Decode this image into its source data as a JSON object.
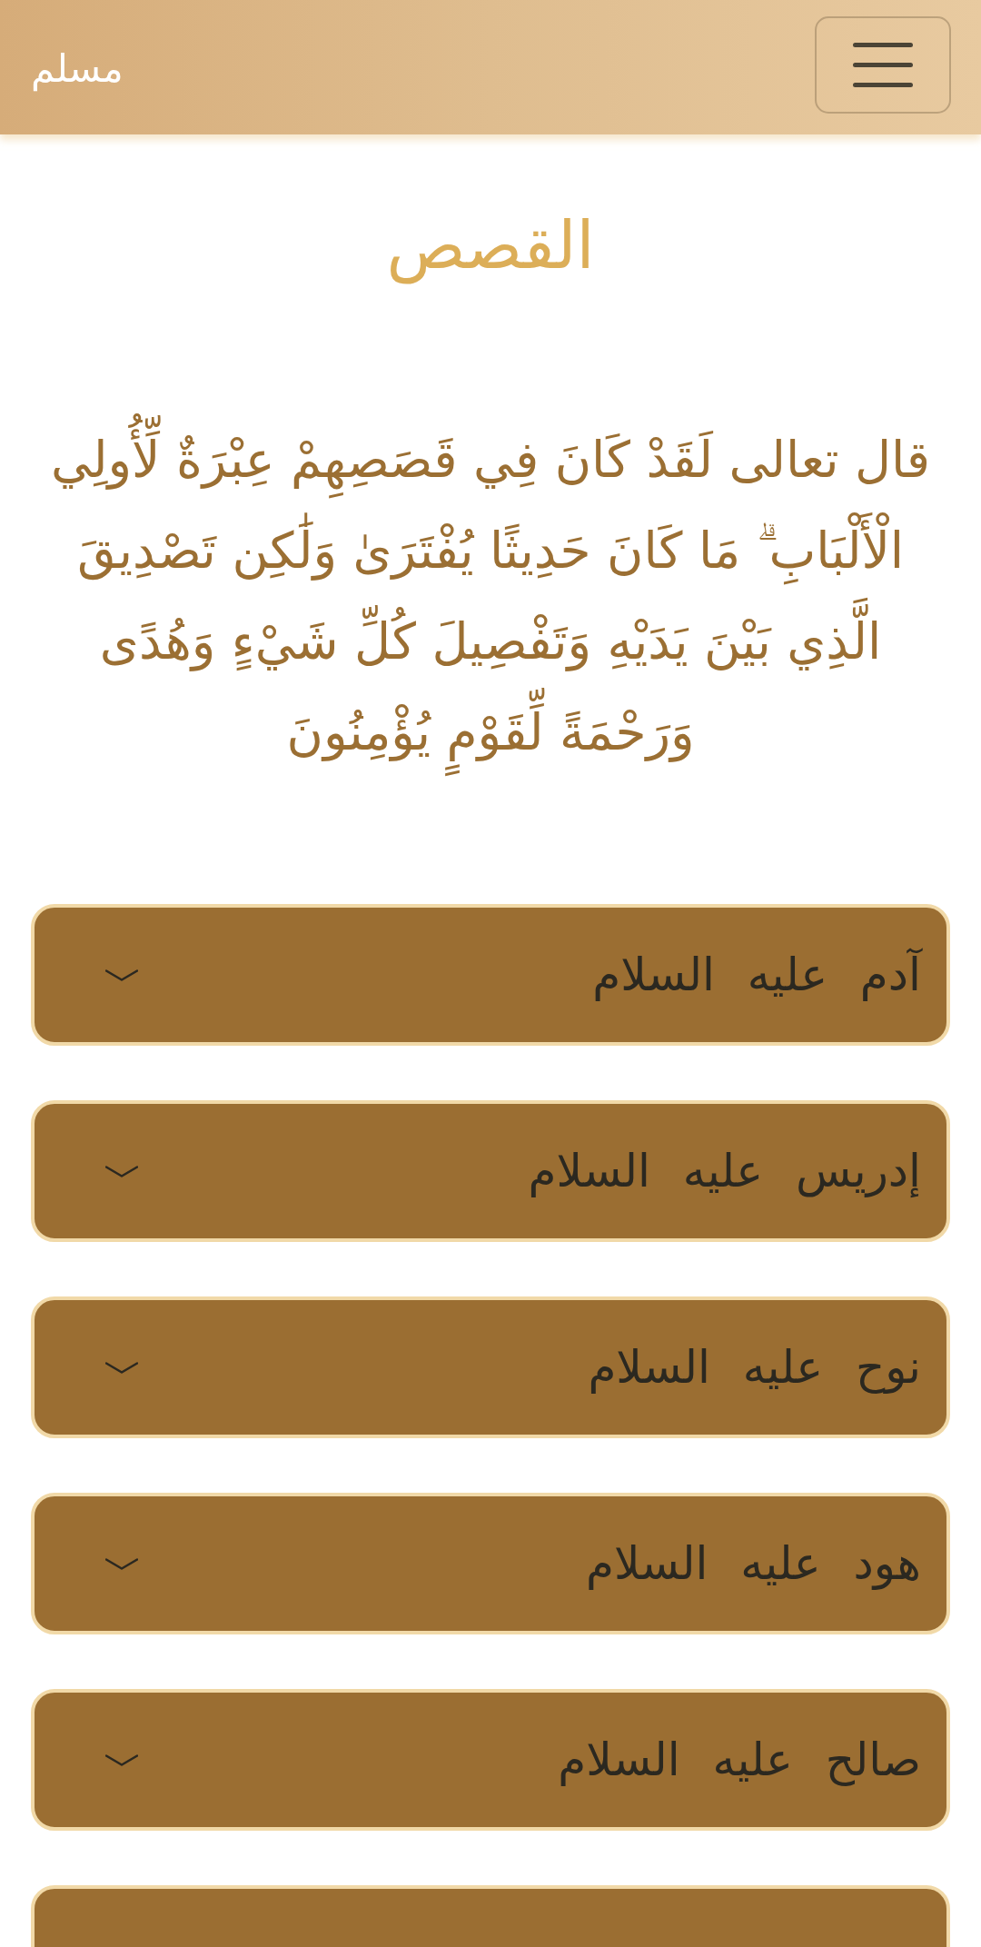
{
  "navbar": {
    "brand": "مسلم"
  },
  "page_title": "القصص",
  "verse": "قال تعالى لَقَدْ كَانَ فِي قَصَصِهِمْ عِبْرَةٌ لِّأُولِي الْأَلْبَابِ ۗ مَا كَانَ حَدِيثًا يُفْتَرَىٰ وَلَٰكِن تَصْدِيقَ الَّذِي بَيْنَ يَدَيْهِ وَتَفْصِيلَ كُلِّ شَيْءٍ وَهُدًى وَرَحْمَةً لِّقَوْمٍ يُؤْمِنُونَ",
  "accordion": {
    "items": [
      {
        "title": "آدم عليه السلام",
        "expanded": false
      },
      {
        "title": "إدريس عليه السلام",
        "expanded": false
      },
      {
        "title": "نوح عليه السلام",
        "expanded": false
      },
      {
        "title": "هود عليه السلام",
        "expanded": false
      },
      {
        "title": "صالح عليه السلام",
        "expanded": false
      }
    ],
    "next_item_partly_visible": true
  }
}
